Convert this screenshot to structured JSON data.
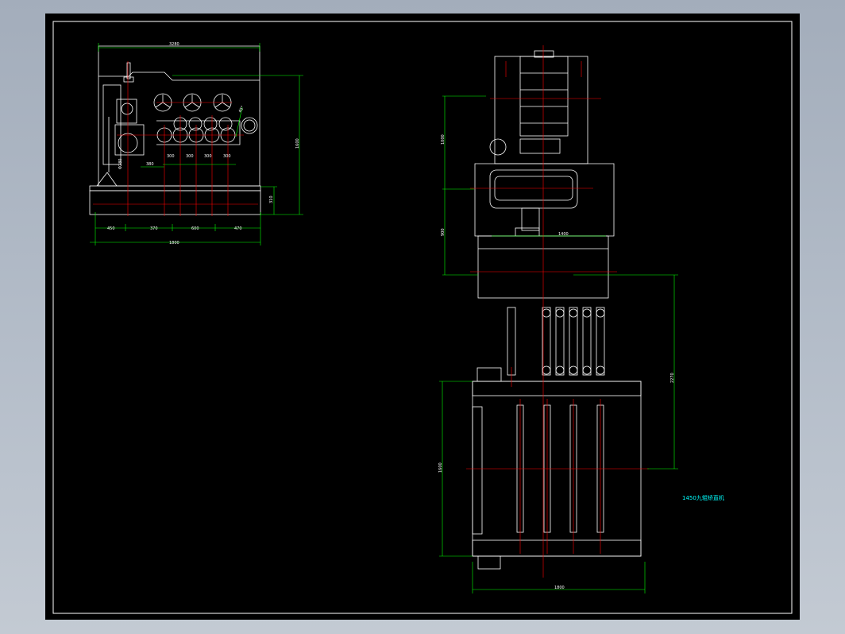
{
  "drawing": {
    "title_note": "1450九辊矫直机",
    "colors": {
      "background": "#000000",
      "outline": "#ffffff",
      "dimension": "#00ff00",
      "centerline": "#ff0000",
      "note": "#00ffff"
    }
  },
  "side_view": {
    "overall_width": "3280",
    "overall_height": "1600",
    "base_height": "310",
    "roll_angle": "45°",
    "roll_diameter": "Φ280",
    "roll_offset": "380",
    "roll_pitches": [
      "300",
      "300",
      "300",
      "300"
    ],
    "base_segments": [
      "450",
      "370",
      "600",
      "470"
    ],
    "base_total": "1800"
  },
  "front_view": {
    "motor_height": "1000",
    "gearbox_height": "900",
    "gearbox_width": "1400",
    "shaft_length": "2270",
    "frame_height": "1600",
    "frame_width": "1800"
  }
}
